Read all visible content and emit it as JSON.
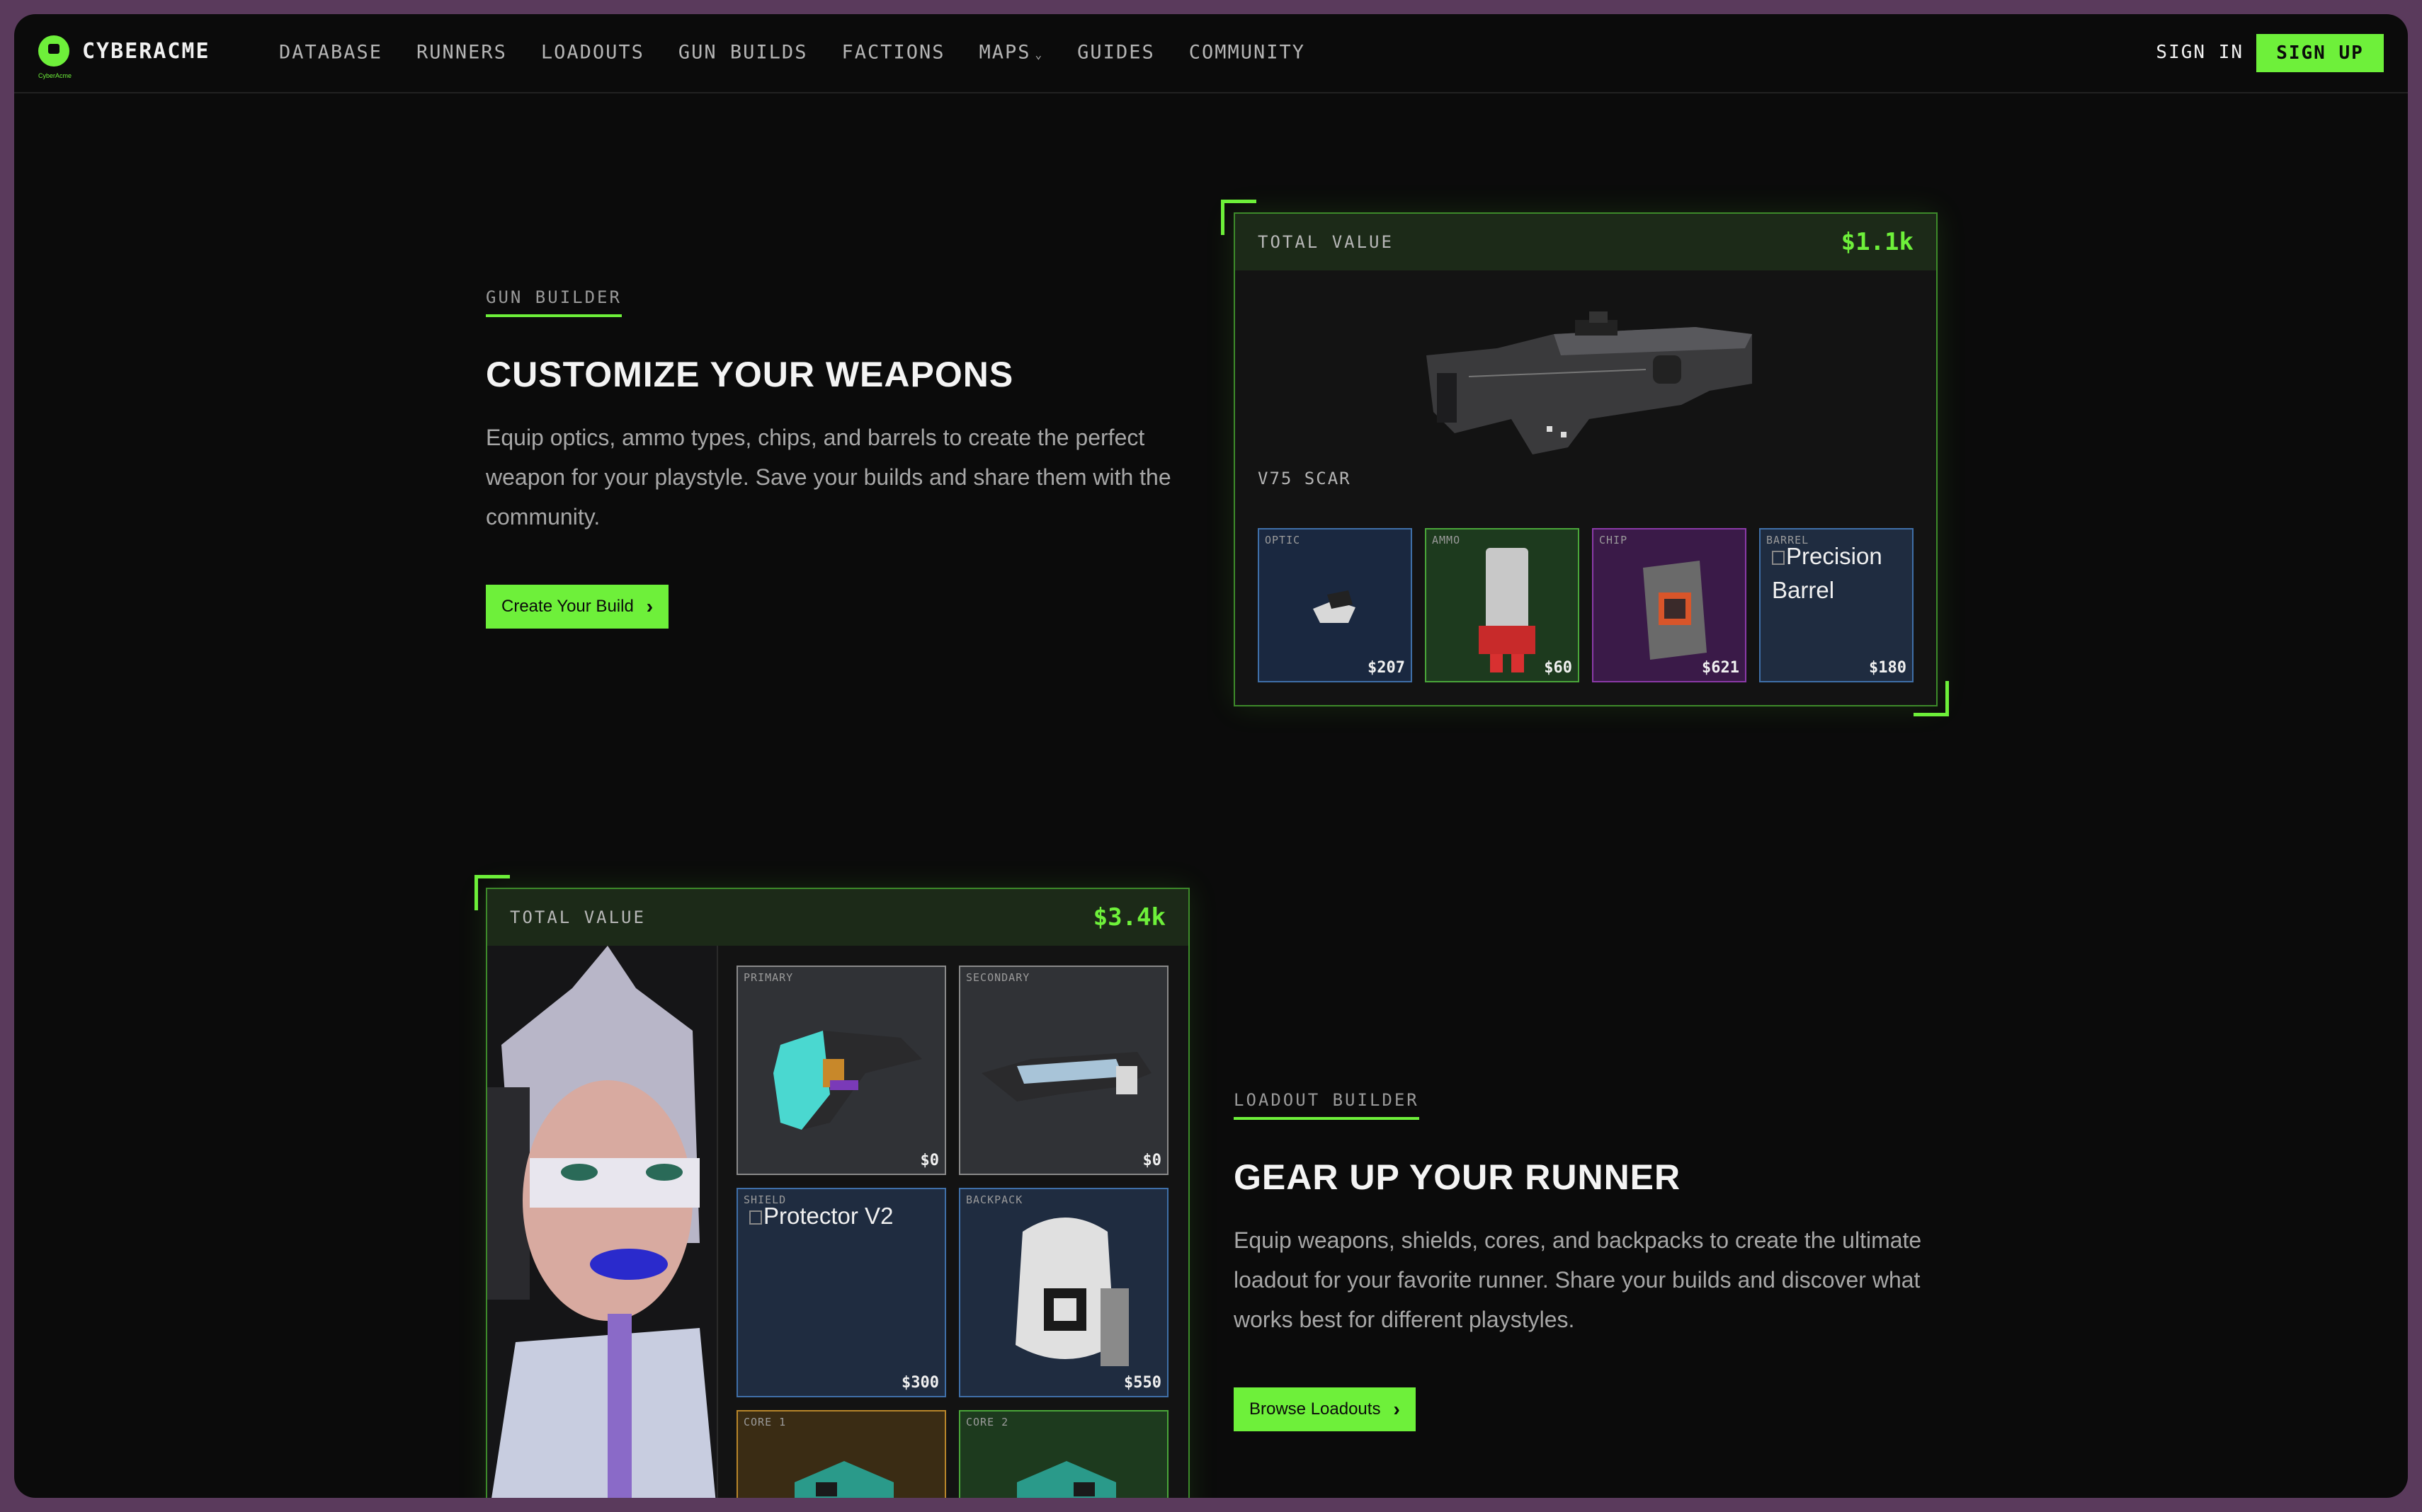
{
  "nav": {
    "logo_text": "CYBERACME",
    "logo_sub": "CyberAcme",
    "links": [
      "DATABASE",
      "RUNNERS",
      "LOADOUTS",
      "GUN BUILDS",
      "FACTIONS",
      "MAPS",
      "GUIDES",
      "COMMUNITY"
    ],
    "sign_in": "SIGN IN",
    "sign_up": "SIGN UP"
  },
  "gun_builder": {
    "eyebrow": "GUN BUILDER",
    "title": "CUSTOMIZE YOUR WEAPONS",
    "description": "Equip optics, ammo types, chips, and barrels to create the perfect weapon for your playstyle. Save your builds and share them with the community.",
    "cta": "Create Your Build",
    "card": {
      "total_label": "TOTAL VALUE",
      "total_value": "$1.1k",
      "weapon_name": "V75 SCAR",
      "slots": [
        {
          "label": "OPTIC",
          "price": "$207",
          "border": "#3f6fa8",
          "bg": "#1a2840"
        },
        {
          "label": "AMMO",
          "price": "$60",
          "border": "#4aa63a",
          "bg": "#1d3a1e"
        },
        {
          "label": "CHIP",
          "price": "$621",
          "border": "#8b3aa8",
          "bg": "#3a1a48"
        },
        {
          "label": "BARREL",
          "price": "$180",
          "border": "#3f6fa8",
          "bg": "#1f2c40",
          "alt": "Precision Barrel"
        }
      ]
    }
  },
  "loadout_builder": {
    "eyebrow": "LOADOUT BUILDER",
    "title": "GEAR UP YOUR RUNNER",
    "description": "Equip weapons, shields, cores, and backpacks to create the ultimate loadout for your favorite runner. Share your builds and discover what works best for different playstyles.",
    "cta": "Browse Loadouts",
    "card": {
      "total_label": "TOTAL VALUE",
      "total_value": "$3.4k",
      "slots": [
        {
          "label": "PRIMARY",
          "price": "$0",
          "border": "#8a8a8a",
          "bg": "#303236"
        },
        {
          "label": "SECONDARY",
          "price": "$0",
          "border": "#8a8a8a",
          "bg": "#303236"
        },
        {
          "label": "SHIELD",
          "price": "$300",
          "border": "#3f6fa8",
          "bg": "#1f2c40",
          "alt": "Protector V2"
        },
        {
          "label": "BACKPACK",
          "price": "$550",
          "border": "#3f6fa8",
          "bg": "#1f2c40"
        },
        {
          "label": "CORE 1",
          "price": "",
          "border": "#b8862a",
          "bg": "#3a2c14"
        },
        {
          "label": "CORE 2",
          "price": "",
          "border": "#4aa63a",
          "bg": "#1d3a1e"
        }
      ]
    }
  },
  "colors": {
    "accent": "#6ef03a",
    "background": "#0b0b0b",
    "outer": "#5a3a5c"
  }
}
